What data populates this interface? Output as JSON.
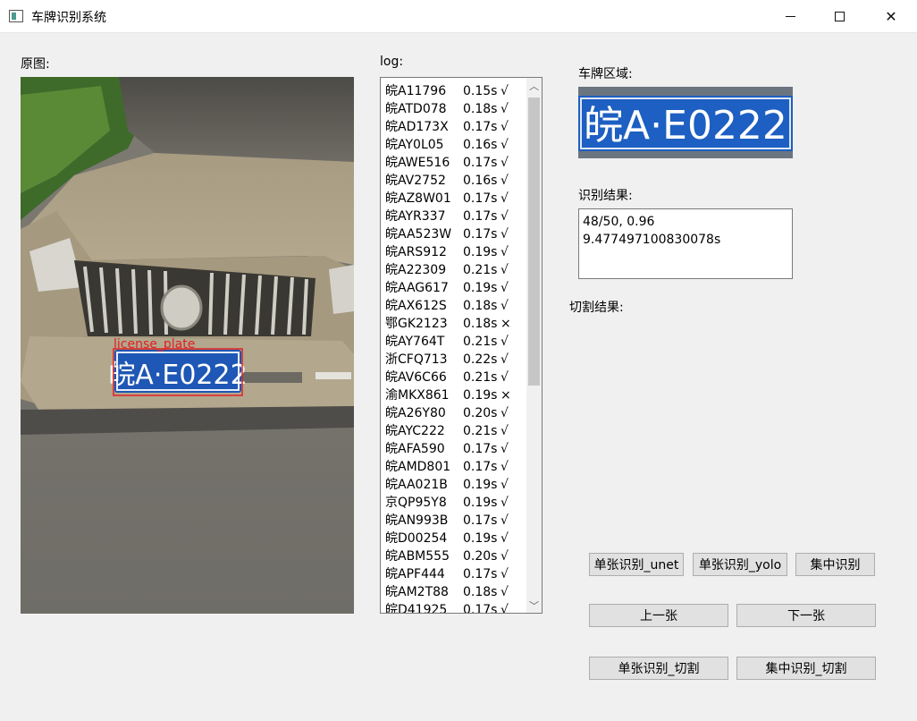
{
  "window": {
    "title": "车牌识别系统",
    "icon": "app-window-icon",
    "minimize_icon": "minimize-icon",
    "maximize_icon": "maximize-icon",
    "close_icon": "close-icon",
    "close_glyph": "✕"
  },
  "labels": {
    "original": "原图:",
    "log": "log:",
    "plate_region": "车牌区域:",
    "result": "识别结果:",
    "segment": "切割结果:"
  },
  "photo": {
    "detection_label": "license_plate",
    "detection_color": "#e02020",
    "plate_text": "皖A·E0222"
  },
  "plate_crop": {
    "plate_text": "皖A·E0222"
  },
  "result": {
    "line1": "48/50, 0.96",
    "line2": "9.477497100830078s"
  },
  "log": [
    {
      "plate": "皖A11796",
      "time": "0.15s",
      "mark": "√"
    },
    {
      "plate": "皖ATD078",
      "time": "0.18s",
      "mark": "√"
    },
    {
      "plate": "皖AD173X",
      "time": "0.17s",
      "mark": "√"
    },
    {
      "plate": "皖AY0L05",
      "time": "0.16s",
      "mark": "√"
    },
    {
      "plate": "皖AWE516",
      "time": "0.17s",
      "mark": "√"
    },
    {
      "plate": "皖AV2752",
      "time": "0.16s",
      "mark": "√"
    },
    {
      "plate": "皖AZ8W01",
      "time": "0.17s",
      "mark": "√"
    },
    {
      "plate": "皖AYR337",
      "time": "0.17s",
      "mark": "√"
    },
    {
      "plate": "皖AA523W",
      "time": "0.17s",
      "mark": "√"
    },
    {
      "plate": "皖ARS912",
      "time": "0.19s",
      "mark": "√"
    },
    {
      "plate": "皖A22309",
      "time": "0.21s",
      "mark": "√"
    },
    {
      "plate": "皖AAG617",
      "time": "0.19s",
      "mark": "√"
    },
    {
      "plate": "皖AX612S",
      "time": "0.18s",
      "mark": "√"
    },
    {
      "plate": "鄂GK2123",
      "time": "0.18s",
      "mark": "×"
    },
    {
      "plate": "皖AY764T",
      "time": "0.21s",
      "mark": "√"
    },
    {
      "plate": "浙CFQ713",
      "time": "0.22s",
      "mark": "√"
    },
    {
      "plate": "皖AV6C66",
      "time": "0.21s",
      "mark": "√"
    },
    {
      "plate": "渝MKX861",
      "time": "0.19s",
      "mark": "×"
    },
    {
      "plate": "皖A26Y80",
      "time": "0.20s",
      "mark": "√"
    },
    {
      "plate": "皖AYC222",
      "time": "0.21s",
      "mark": "√"
    },
    {
      "plate": "皖AFA590",
      "time": "0.17s",
      "mark": "√"
    },
    {
      "plate": "皖AMD801",
      "time": "0.17s",
      "mark": "√"
    },
    {
      "plate": "皖AA021B",
      "time": "0.19s",
      "mark": "√"
    },
    {
      "plate": "京QP95Y8",
      "time": "0.19s",
      "mark": "√"
    },
    {
      "plate": "皖AN993B",
      "time": "0.17s",
      "mark": "√"
    },
    {
      "plate": "皖D00254",
      "time": "0.19s",
      "mark": "√"
    },
    {
      "plate": "皖ABM555",
      "time": "0.20s",
      "mark": "√"
    },
    {
      "plate": "皖APF444",
      "time": "0.17s",
      "mark": "√"
    },
    {
      "plate": "皖AM2T88",
      "time": "0.18s",
      "mark": "√"
    },
    {
      "plate": "皖D41925",
      "time": "0.17s",
      "mark": "√"
    }
  ],
  "scroll": {
    "up_icon": "scroll-up-arrow-icon",
    "down_icon": "scroll-down-arrow-icon",
    "up_glyph": "︿",
    "down_glyph": "﹀"
  },
  "buttons": {
    "single_unet": "单张识别_unet",
    "single_yolo": "单张识别_yolo",
    "batch": "集中识别",
    "prev": "上一张",
    "next": "下一张",
    "single_segment": "单张识别_切割",
    "batch_segment": "集中识别_切割"
  }
}
